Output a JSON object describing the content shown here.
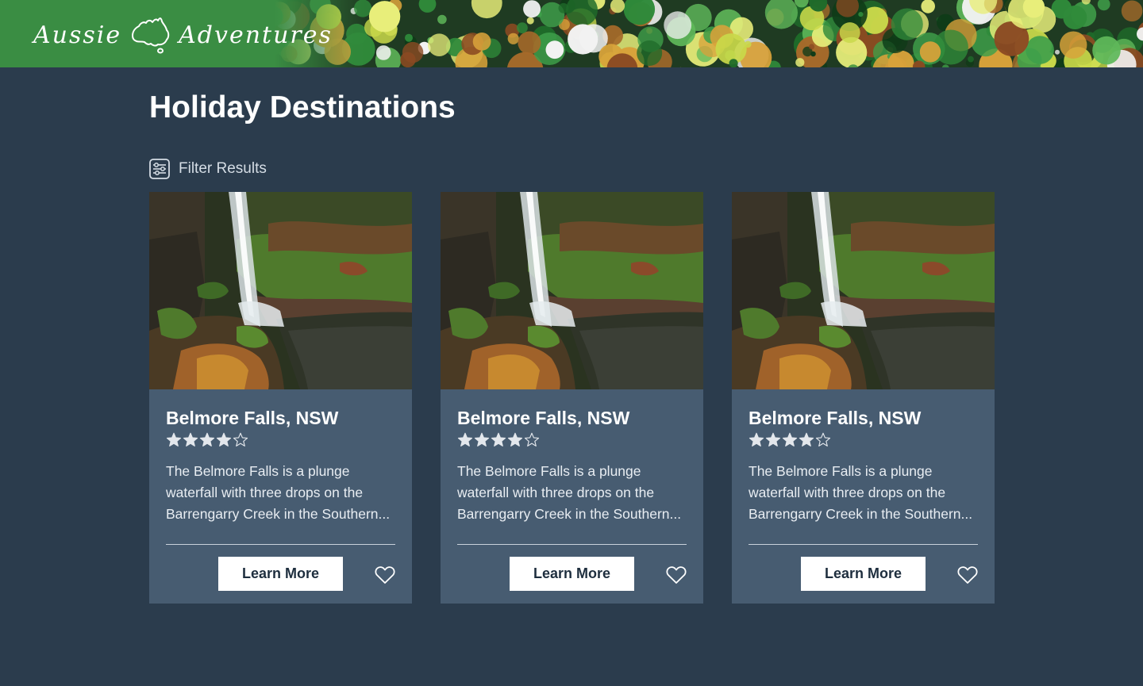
{
  "header": {
    "logo_word1": "Aussie",
    "logo_word2": "Adventures",
    "logo_icon": "australia-map-icon"
  },
  "main": {
    "title": "Holiday Destinations",
    "filter": {
      "label": "Filter Results",
      "icon": "filter-sliders-icon"
    }
  },
  "cards": [
    {
      "title": "Belmore Falls, NSW",
      "rating": 4,
      "rating_max": 5,
      "description": "The Belmore Falls is a plunge waterfall with three drops on the Barrengarry Creek in the Southern...",
      "button_label": "Learn More",
      "favorite_icon": "heart-icon"
    },
    {
      "title": "Belmore Falls, NSW",
      "rating": 4,
      "rating_max": 5,
      "description": "The Belmore Falls is a plunge waterfall with three drops on the Barrengarry Creek in the Southern...",
      "button_label": "Learn More",
      "favorite_icon": "heart-icon"
    },
    {
      "title": "Belmore Falls, NSW",
      "rating": 4,
      "rating_max": 5,
      "description": "The Belmore Falls is a plunge waterfall with three drops on the Barrengarry Creek in the Southern...",
      "button_label": "Learn More",
      "favorite_icon": "heart-icon"
    }
  ],
  "colors": {
    "page_background": "#2b3c4d",
    "card_background": "#475c71",
    "header_green": "#3a8d43",
    "button_background": "#ffffff",
    "button_text": "#1e2e3e"
  }
}
